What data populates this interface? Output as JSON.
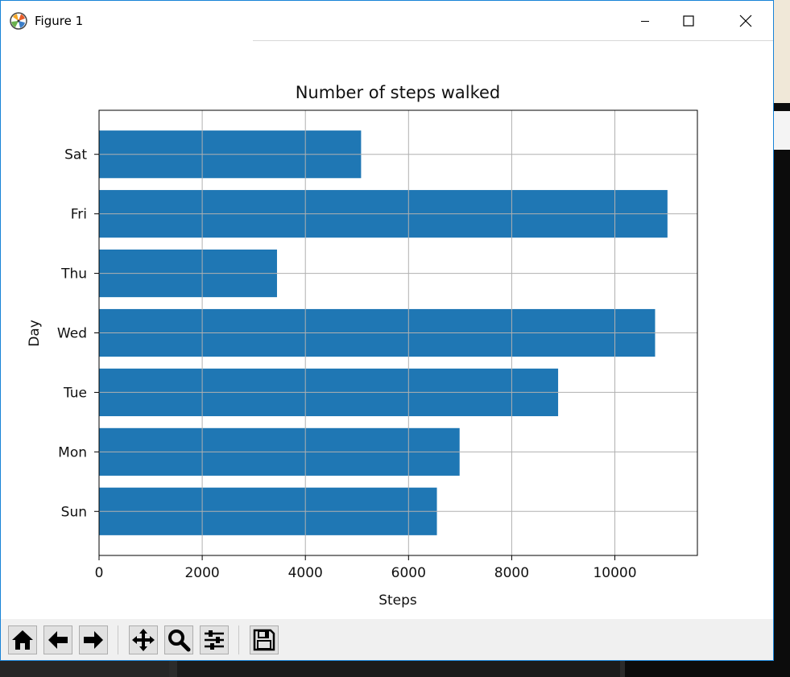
{
  "window": {
    "title": "Figure 1"
  },
  "icons": {
    "app": "matplotlib-icon",
    "minimize": "minimize-icon",
    "maximize": "maximize-icon",
    "close": "close-icon"
  },
  "toolbar": {
    "buttons": [
      "home-icon",
      "back-arrow-icon",
      "forward-arrow-icon",
      "pan-icon",
      "zoom-icon",
      "configure-subplots-icon",
      "save-icon"
    ]
  },
  "colors": {
    "bar": "#1f77b4",
    "grid": "#b0b0b0",
    "window_border": "#1883d7"
  },
  "chart_data": {
    "type": "bar",
    "orientation": "horizontal",
    "title": "Number of steps walked",
    "xlabel": "Steps",
    "ylabel": "Day",
    "categories": [
      "Sun",
      "Mon",
      "Tue",
      "Wed",
      "Thu",
      "Fri",
      "Sat"
    ],
    "values": [
      6550,
      6990,
      8900,
      10780,
      3450,
      11020,
      5080
    ],
    "xlim": [
      0,
      11600
    ],
    "xticks": [
      0,
      2000,
      4000,
      6000,
      8000,
      10000
    ],
    "xtick_labels": [
      "0",
      "2000",
      "4000",
      "6000",
      "8000",
      "10000"
    ],
    "grid": true,
    "legend": "none"
  }
}
